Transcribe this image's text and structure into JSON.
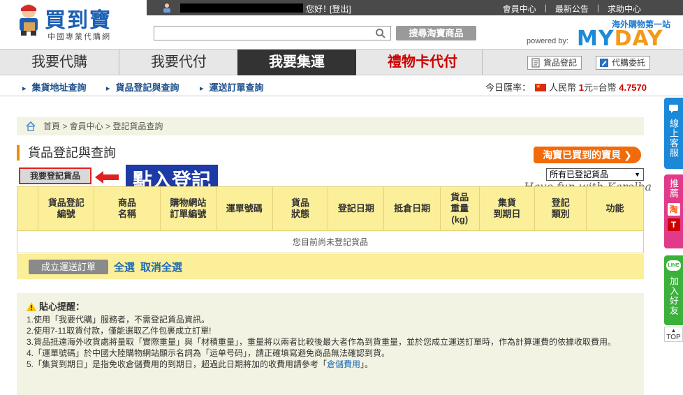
{
  "topbar": {
    "greeting": "您好！",
    "logout": "[登出]",
    "links": [
      "會員中心",
      "最新公告",
      "求助中心"
    ]
  },
  "logo": {
    "name": "買到寶",
    "subtitle": "中國專業代購網"
  },
  "search": {
    "placeholder": "",
    "button": "搜尋淘寶商品"
  },
  "myday": {
    "slogan": "海外購物第一站",
    "powered": "powered by:",
    "brand_a": "MY",
    "brand_b": "DAY"
  },
  "mainnav": {
    "tabs": [
      "我要代購",
      "我要代付",
      "我要集運",
      "禮物卡代付"
    ],
    "active_index": 2,
    "btn_goods": "貨品登記",
    "btn_commission": "代購委託"
  },
  "subnav": {
    "items": [
      "集貨地址查詢",
      "貨品登記與查詢",
      "運送訂單查詢"
    ],
    "rate_label": "今日匯率：",
    "rate_rmb": "人民幣",
    "rate_one": "1",
    "rate_mid": "元=台幣",
    "rate_value": "4.7570"
  },
  "side": {
    "chat": "線上客服",
    "recommend": "推薦",
    "taobao_icon": "淘",
    "t_icon": "T",
    "line_badge": "LINE",
    "line": "加入好友",
    "top": "TOP"
  },
  "breadcrumb": "首頁 > 會員中心 > 登記貨品查詢",
  "page_title": "貨品登記與查詢",
  "promo_button": "淘寶已買到的寶貝 ❯",
  "register_button": "我要登記貨品",
  "callout": "點入登記",
  "filter_select": "所有已登記貨品",
  "watermark": "Have fun with Karolba",
  "table": {
    "headers": [
      "",
      "貨品登記\n編號",
      "商品\n名稱",
      "購物網站\n訂單編號",
      "運單號碼",
      "貨品\n狀態",
      "登記日期",
      "抵倉日期",
      "貨品\n重量\n(kg)",
      "集貨\n到期日",
      "登記\n類別",
      "功能"
    ],
    "empty_text": "您目前尚未登記貨品"
  },
  "footer": {
    "create": "成立運送訂單",
    "select_all": "全選",
    "deselect_all": "取消全選"
  },
  "tips": {
    "title": "貼心提醒：",
    "items": [
      "1.使用「我要代購」服務者，不需登記貨品資訊。",
      "2.使用7-11取貨付款，僅能選取乙件包裹成立訂單!",
      "3.貨品抵達海外收貨處將量取「實際重量」與「材積重量」，重量將以兩者比較後最大者作為到貨重量，並於您成立運送訂單時，作為計算運費的依據收取費用。",
      "4.「運單號碼」於中國大陸購物網站顯示名詞為「运单号码」，請正確填寫避免商品無法確認到貨。"
    ],
    "item5_a": "5.「集貨到期日」是指免收倉儲費用的到期日，超過此日期將加的收費用請參考「",
    "item5_link": "倉儲費用",
    "item5_b": "」。"
  },
  "colors": {
    "accent": "#f08c00",
    "brand_blue": "#1b5fb4",
    "table_header": "#fcef99",
    "callout": "#1d3aa6"
  }
}
